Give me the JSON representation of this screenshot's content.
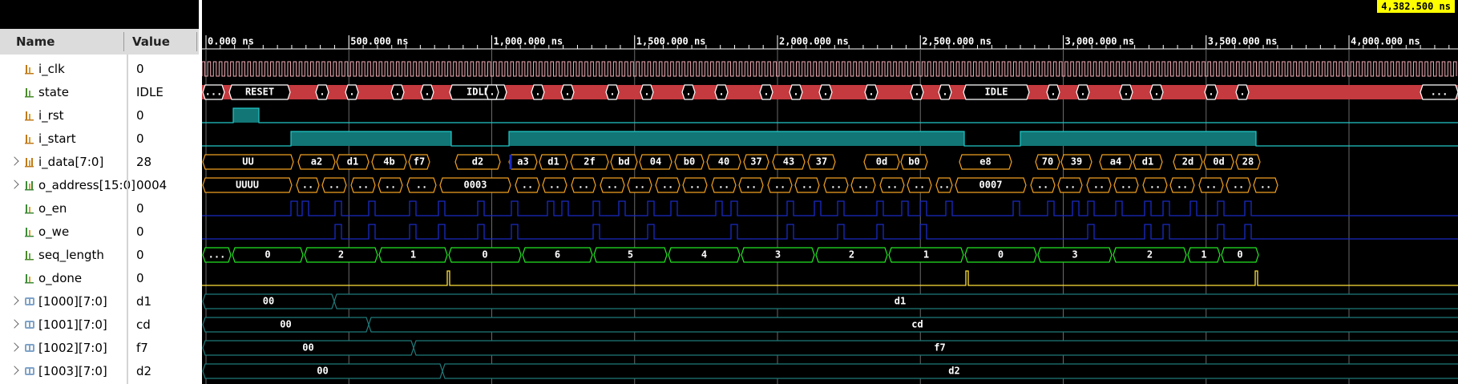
{
  "cursor_time": "4,382.500 ns",
  "columns": {
    "name": "Name",
    "value": "Value"
  },
  "colors": {
    "clock": "#f3aeb7",
    "state_fill": "#c43a3f",
    "cyan": "#22c8c8",
    "teal_fill": "#127676",
    "yellow": "#ffe13a",
    "bus_blue": "#1a2bc4",
    "green": "#22e622",
    "orange": "#f0a020",
    "mem_teal": "#1f7a7a"
  },
  "timeline_ticks": [
    "0.000 ns",
    "500.000 ns",
    "1,000.000 ns",
    "1,500.000 ns",
    "2,000.000 ns",
    "2,500.000 ns",
    "3,000.000 ns",
    "3,500.000 ns",
    "4,000.000 ns"
  ],
  "signals": [
    {
      "name": "i_clk",
      "value": "0",
      "icon": "input-bit-icon",
      "expandable": false
    },
    {
      "name": "state",
      "value": "IDLE",
      "icon": "internal-bit-icon",
      "expandable": false
    },
    {
      "name": "i_rst",
      "value": "0",
      "icon": "input-bit-icon",
      "expandable": false
    },
    {
      "name": "i_start",
      "value": "0",
      "icon": "input-bit-icon",
      "expandable": false
    },
    {
      "name": "i_data[7:0]",
      "value": "28",
      "icon": "input-bus-icon",
      "expandable": true
    },
    {
      "name": "o_address[15:0]",
      "value": "0004",
      "icon": "output-bus-icon",
      "expandable": true
    },
    {
      "name": "o_en",
      "value": "0",
      "icon": "output-bit-icon",
      "expandable": false
    },
    {
      "name": "o_we",
      "value": "0",
      "icon": "output-bit-icon",
      "expandable": false
    },
    {
      "name": "seq_length",
      "value": "0",
      "icon": "internal-bit-icon",
      "expandable": false
    },
    {
      "name": "o_done",
      "value": "0",
      "icon": "output-bit-icon",
      "expandable": false
    },
    {
      "name": "[1000][7:0]",
      "value": "d1",
      "icon": "memory-array-icon",
      "expandable": true
    },
    {
      "name": "[1001][7:0]",
      "value": "cd",
      "icon": "memory-array-icon",
      "expandable": true
    },
    {
      "name": "[1002][7:0]",
      "value": "f7",
      "icon": "memory-array-icon",
      "expandable": true
    },
    {
      "name": "[1003][7:0]",
      "value": "d2",
      "icon": "memory-array-icon",
      "expandable": true
    }
  ],
  "waves": {
    "state_labels": [
      "...",
      "RESET",
      "IDLE",
      "IDLE",
      "..."
    ],
    "i_data_labels": [
      "UU",
      "a2",
      "d1",
      "4b",
      "f7",
      "d2",
      "a3",
      "d1",
      "2f",
      "bd",
      "04",
      "b0",
      "40",
      "37",
      "43",
      "37",
      "0d",
      "b0",
      "e8",
      "70",
      "39",
      "a4",
      "d1",
      "2d",
      "0d",
      "28"
    ],
    "o_address_labels": [
      "UUUU",
      "0003",
      "0007"
    ],
    "seq_length_labels": [
      "...",
      "0",
      "2",
      "1",
      "0",
      "6",
      "5",
      "4",
      "3",
      "2",
      "1",
      "0",
      "3",
      "2",
      "1",
      "0"
    ],
    "mem_labels": [
      [
        "00",
        "d1"
      ],
      [
        "00",
        "cd"
      ],
      [
        "00",
        "f7"
      ],
      [
        "00",
        "d2"
      ]
    ]
  }
}
